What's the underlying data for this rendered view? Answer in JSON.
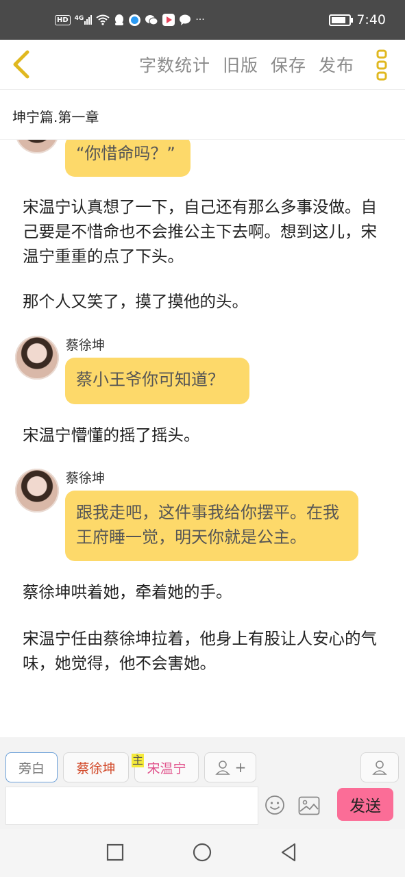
{
  "status_bar": {
    "hd": "HD",
    "network": "4G",
    "more": "···",
    "time": "7:40"
  },
  "toolbar": {
    "actions": [
      "字数统计",
      "旧版",
      "保存",
      "发布"
    ],
    "accent": "#e0b820"
  },
  "chapter": {
    "title": "坤宁篇.第一章"
  },
  "story": {
    "bubble1": "“你惜命吗？”",
    "narration1": "宋温宁认真想了一下，自己还有那么多事没做。自己要是不惜命也不会推公主下去啊。想到这儿，宋温宁重重的点了下头。",
    "narration2": "那个人又笑了，摸了摸他的头。",
    "speaker2": "蔡徐坤",
    "bubble2": "蔡小王爷你可知道？",
    "narration3": "宋温宁懵懂的摇了摇头。",
    "speaker3": "蔡徐坤",
    "bubble3": "跟我走吧，这件事我给你摆平。在我王府睡一觉，明天你就是公主。",
    "narration4": "蔡徐坤哄着她，牵着她的手。",
    "narration5": "宋温宁任由蔡徐坤拉着，他身上有股让人安心的气味，她觉得，他不会害她。"
  },
  "bottom": {
    "roles": {
      "narrator": "旁白",
      "cai": "蔡徐坤",
      "song": "宋温宁",
      "main_tag": "主",
      "add": "+"
    },
    "input_value": "",
    "send_label": "发送",
    "send_color": "#fb6d97",
    "bubble_color": "#fdd96a"
  },
  "icons": [
    "back-chevron-icon",
    "more-dots-icon",
    "add-role-icon",
    "user-icon",
    "emoji-icon",
    "image-icon",
    "nav-square-icon",
    "nav-circle-icon",
    "nav-back-icon"
  ]
}
